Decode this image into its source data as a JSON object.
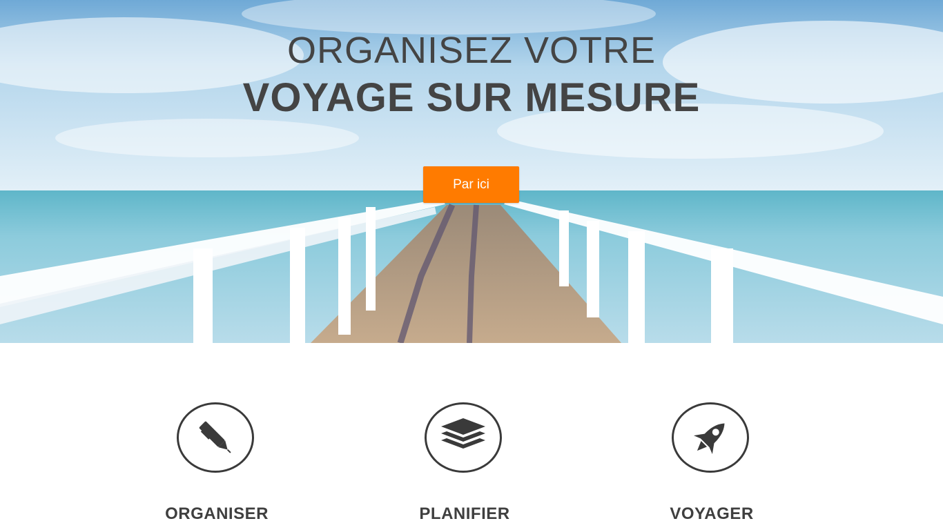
{
  "hero": {
    "title_line1": "ORGANISEZ VOTRE",
    "title_line2": "VOYAGE SUR MESURE",
    "cta_label": "Par ici",
    "cta_color": "#ff7b00",
    "background": "pier-over-sea-image"
  },
  "features": [
    {
      "label": "ORGANISER",
      "icon": "pen-icon"
    },
    {
      "label": "PLANIFIER",
      "icon": "layers-icon"
    },
    {
      "label": "VOYAGER",
      "icon": "rocket-icon"
    }
  ]
}
